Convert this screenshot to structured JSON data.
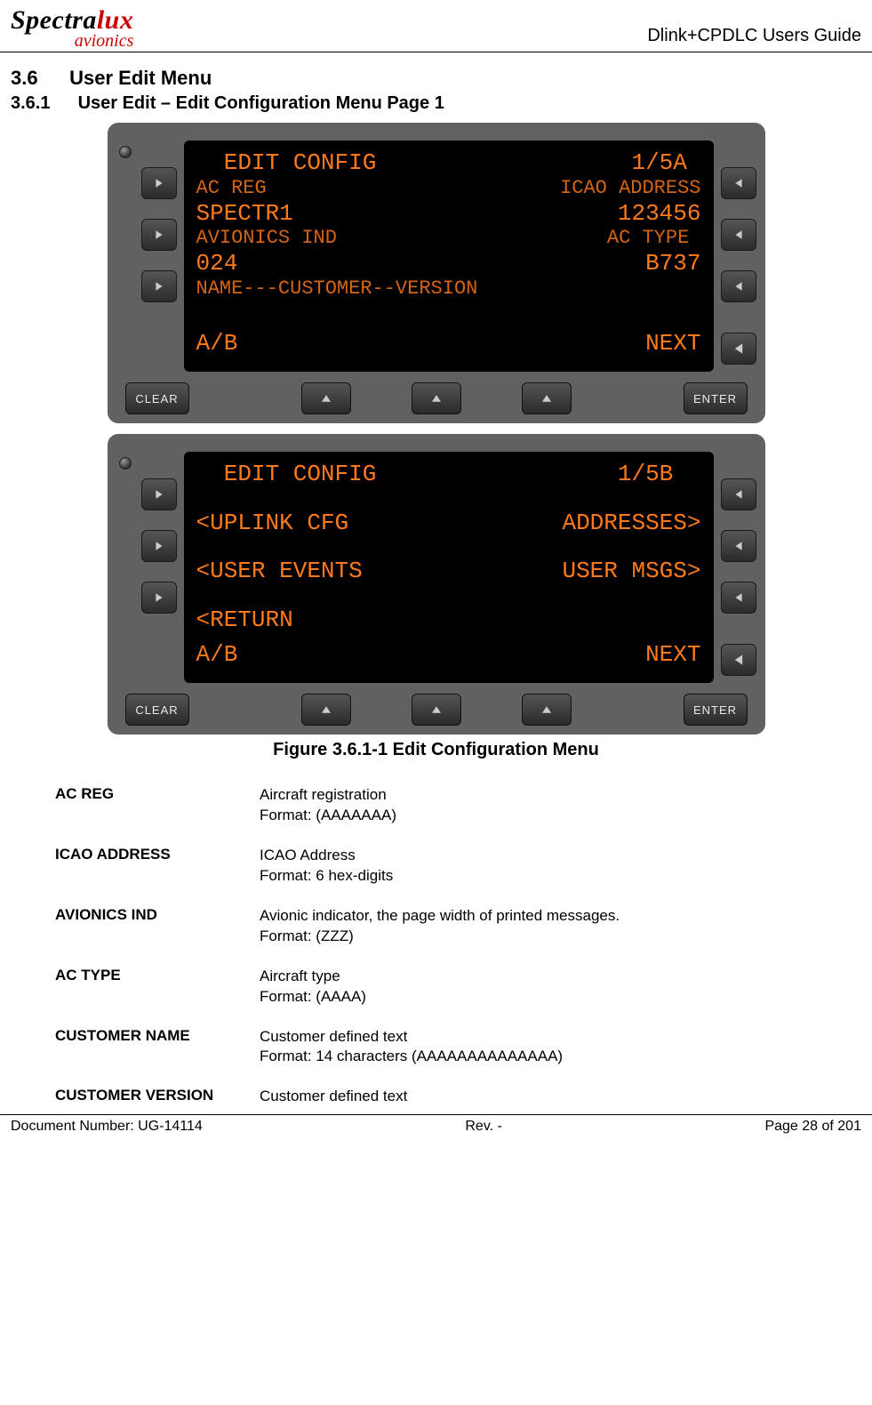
{
  "header": {
    "logo_main_black": "Spectra",
    "logo_main_red": "lux",
    "logo_sub": "avionics",
    "doc_title": "Dlink+CPDLC Users Guide"
  },
  "headings": {
    "sec_num": "3.6",
    "sec_title": "User Edit Menu",
    "subsec_num": "3.6.1",
    "subsec_title": "User Edit – Edit Configuration Menu Page 1"
  },
  "panelA": {
    "title": "EDIT CONFIG",
    "page": "1/5A",
    "ac_reg_label": "AC REG",
    "icao_label": "ICAO ADDRESS",
    "ac_reg_value": "SPECTR1",
    "icao_value": "123456",
    "av_ind_label": "AVIONICS IND",
    "ac_type_label": "AC TYPE",
    "av_ind_value": "024",
    "ac_type_value": "B737",
    "name_row": "NAME---CUSTOMER--VERSION",
    "ab": "A/B",
    "next": "NEXT"
  },
  "panelB": {
    "title": "EDIT CONFIG",
    "page": "1/5B",
    "uplink": "<UPLINK CFG",
    "addresses": "ADDRESSES>",
    "user_events": "<USER EVENTS",
    "user_msgs": "USER MSGS>",
    "return": "<RETURN",
    "ab": "A/B",
    "next": "NEXT"
  },
  "hardware": {
    "clear": "CLEAR",
    "enter": "ENTER"
  },
  "figure_caption": "Figure 3.6.1-1 Edit Configuration Menu",
  "fields": [
    {
      "name": "AC REG",
      "desc1": "Aircraft registration",
      "desc2": "Format: (AAAAAAA)"
    },
    {
      "name": "ICAO ADDRESS",
      "desc1": "ICAO Address",
      "desc2": "Format: 6 hex-digits"
    },
    {
      "name": "AVIONICS IND",
      "desc1": "Avionic indicator, the page width of printed messages.",
      "desc2": "Format: (ZZZ)"
    },
    {
      "name": "AC TYPE",
      "desc1": "Aircraft type",
      "desc2": "Format: (AAAA)"
    },
    {
      "name": "CUSTOMER NAME",
      "desc1": "Customer defined text",
      "desc2": "Format: 14 characters (AAAAAAAAAAAAAA)"
    },
    {
      "name": "CUSTOMER VERSION",
      "desc1": "Customer defined text",
      "desc2": ""
    }
  ],
  "footer": {
    "doc_number": "Document Number:  UG-14114",
    "rev": "Rev. -",
    "page": "Page 28 of 201"
  }
}
